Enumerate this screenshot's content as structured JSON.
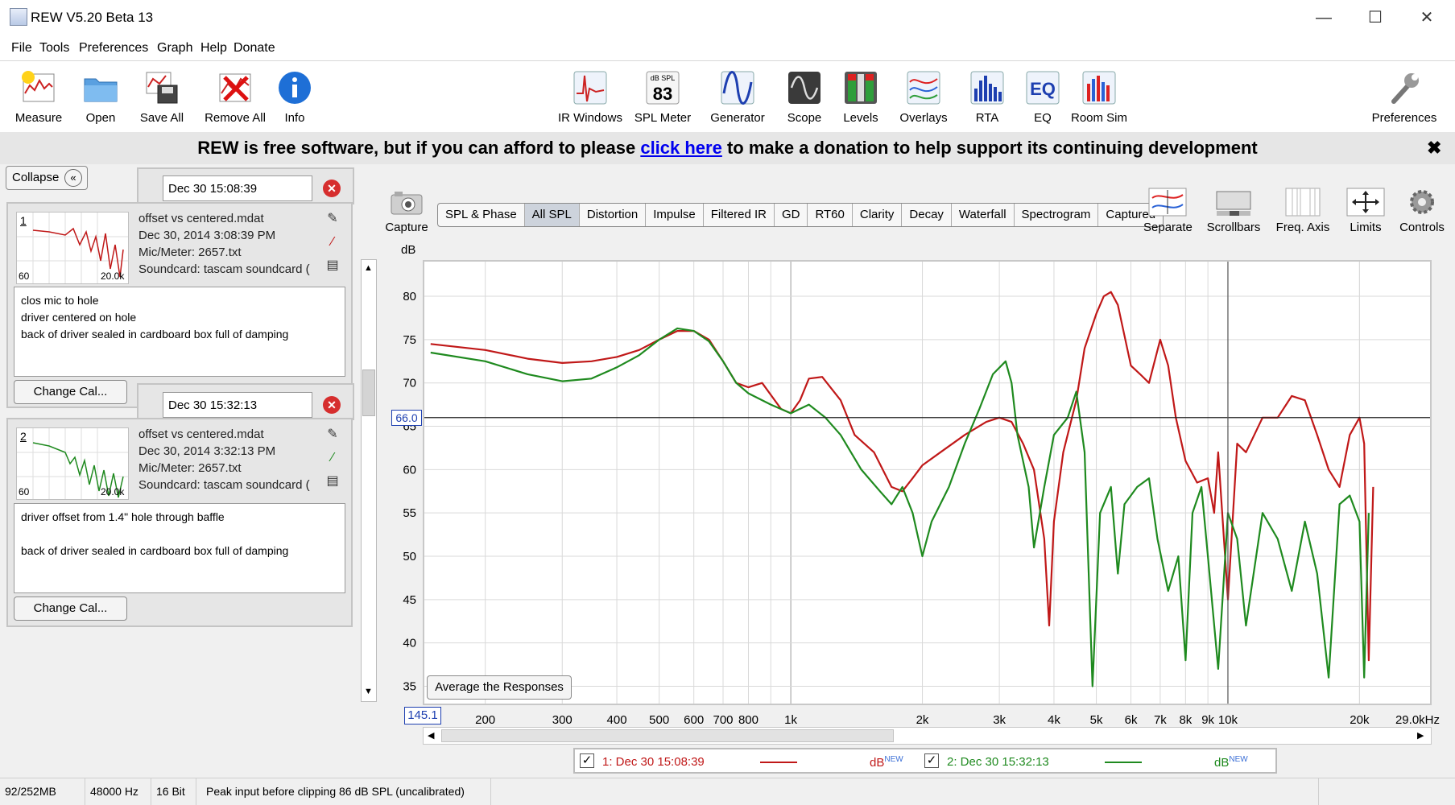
{
  "window": {
    "title": "REW V5.20 Beta 13"
  },
  "menu": [
    "File",
    "Tools",
    "Preferences",
    "Graph",
    "Help",
    "Donate"
  ],
  "toolbar": {
    "left": [
      {
        "label": "Measure",
        "icon": "measure-icon"
      },
      {
        "label": "Open",
        "icon": "folder-icon"
      },
      {
        "label": "Save All",
        "icon": "save-icon"
      },
      {
        "label": "Remove All",
        "icon": "remove-icon"
      },
      {
        "label": "Info",
        "icon": "info-icon"
      }
    ],
    "center": [
      {
        "label": "IR Windows",
        "icon": "ir-windows-icon"
      },
      {
        "label": "SPL Meter",
        "icon": "spl-meter-icon"
      },
      {
        "label": "Generator",
        "icon": "generator-icon"
      },
      {
        "label": "Scope",
        "icon": "scope-icon"
      },
      {
        "label": "Levels",
        "icon": "levels-icon"
      },
      {
        "label": "Overlays",
        "icon": "overlays-icon"
      },
      {
        "label": "RTA",
        "icon": "rta-icon"
      },
      {
        "label": "EQ",
        "icon": "eq-icon"
      },
      {
        "label": "Room Sim",
        "icon": "room-sim-icon"
      }
    ],
    "spl_icon_text": "dB SPL",
    "spl_icon_value": "83",
    "eq_icon_text": "EQ",
    "right": {
      "label": "Preferences",
      "icon": "wrench-icon"
    }
  },
  "donate": {
    "before": "REW is free software, but if you can afford to please ",
    "link": "click here",
    "after": " to make a donation to help support its continuing development"
  },
  "panel": {
    "collapse": "Collapse",
    "measurements": [
      {
        "num": "1",
        "date_field": "Dec 30 15:08:39",
        "file": "offset vs centered.mdat",
        "timestamp": "Dec 30, 2014 3:08:39 PM",
        "mic": "Mic/Meter: 2657.txt",
        "soundcard": "Soundcard: tascam soundcard (",
        "notes": [
          "clos mic  to hole",
          "driver centered on hole",
          "back of driver sealed in cardboard box full of damping"
        ],
        "thumb_min": "60",
        "thumb_max": "20.0k",
        "change_cal": "Change Cal..."
      },
      {
        "num": "2",
        "date_field": "Dec 30 15:32:13",
        "file": "offset vs centered.mdat",
        "timestamp": "Dec 30, 2014 3:32:13 PM",
        "mic": "Mic/Meter: 2657.txt",
        "soundcard": "Soundcard: tascam soundcard (",
        "notes": [
          "driver offset from 1.4\" hole through baffle",
          "",
          "back of driver sealed in cardboard box full of damping"
        ],
        "thumb_min": "60",
        "thumb_max": "20.0k",
        "change_cal": "Change Cal..."
      }
    ]
  },
  "graph": {
    "tabs": [
      "SPL & Phase",
      "All SPL",
      "Distortion",
      "Impulse",
      "Filtered IR",
      "GD",
      "RT60",
      "Clarity",
      "Decay",
      "Waterfall",
      "Spectrogram",
      "Captured"
    ],
    "selected_tab": "All SPL",
    "capture": "Capture",
    "right_tools": [
      "Separate",
      "Scrollbars",
      "Freq. Axis",
      "Limits",
      "Controls"
    ],
    "average_button": "Average the Responses",
    "cursor_level": "66.0",
    "cursor_freq": "145.1"
  },
  "chart_data": {
    "type": "line",
    "ylabel": "dB",
    "xscale": "log",
    "xlim": [
      145.1,
      29000
    ],
    "ylim": [
      33,
      84
    ],
    "y_ticks": [
      80,
      75,
      70,
      65,
      60,
      55,
      50,
      45,
      40,
      35
    ],
    "x_ticks": [
      {
        "v": 200,
        "t": "200"
      },
      {
        "v": 300,
        "t": "300"
      },
      {
        "v": 400,
        "t": "400"
      },
      {
        "v": 500,
        "t": "500"
      },
      {
        "v": 600,
        "t": "600"
      },
      {
        "v": 700,
        "t": "700"
      },
      {
        "v": 800,
        "t": "800"
      },
      {
        "v": 1000,
        "t": "1k"
      },
      {
        "v": 2000,
        "t": "2k"
      },
      {
        "v": 3000,
        "t": "3k"
      },
      {
        "v": 4000,
        "t": "4k"
      },
      {
        "v": 5000,
        "t": "5k"
      },
      {
        "v": 6000,
        "t": "6k"
      },
      {
        "v": 7000,
        "t": "7k"
      },
      {
        "v": 8000,
        "t": "8k"
      },
      {
        "v": 9000,
        "t": "9k"
      },
      {
        "v": 10000,
        "t": "10k"
      },
      {
        "v": 20000,
        "t": "20k"
      },
      {
        "v": 29000,
        "t": "29.0kHz"
      }
    ],
    "grid": true,
    "series": [
      {
        "name": "1: Dec 30 15:08:39",
        "color": "#c01818",
        "points": [
          [
            150,
            74.5
          ],
          [
            200,
            73.8
          ],
          [
            250,
            72.8
          ],
          [
            300,
            72.3
          ],
          [
            350,
            72.5
          ],
          [
            400,
            73
          ],
          [
            450,
            73.8
          ],
          [
            500,
            75
          ],
          [
            550,
            76
          ],
          [
            600,
            76
          ],
          [
            650,
            75
          ],
          [
            700,
            72.5
          ],
          [
            750,
            70
          ],
          [
            800,
            69.5
          ],
          [
            860,
            70
          ],
          [
            950,
            67
          ],
          [
            1000,
            66.5
          ],
          [
            1050,
            68
          ],
          [
            1100,
            70.5
          ],
          [
            1180,
            70.7
          ],
          [
            1300,
            68
          ],
          [
            1400,
            64
          ],
          [
            1550,
            62
          ],
          [
            1700,
            58
          ],
          [
            1800,
            57.5
          ],
          [
            1900,
            59
          ],
          [
            2000,
            60.5
          ],
          [
            2200,
            62
          ],
          [
            2500,
            64
          ],
          [
            2800,
            65.5
          ],
          [
            3000,
            66
          ],
          [
            3200,
            65.5
          ],
          [
            3400,
            63
          ],
          [
            3600,
            60
          ],
          [
            3800,
            52
          ],
          [
            3900,
            42
          ],
          [
            4000,
            54
          ],
          [
            4200,
            62
          ],
          [
            4500,
            68
          ],
          [
            4700,
            74
          ],
          [
            5000,
            78
          ],
          [
            5200,
            80
          ],
          [
            5400,
            80.5
          ],
          [
            5600,
            79
          ],
          [
            6000,
            72
          ],
          [
            6300,
            71
          ],
          [
            6600,
            70
          ],
          [
            7000,
            75
          ],
          [
            7300,
            72
          ],
          [
            7600,
            66
          ],
          [
            8000,
            61
          ],
          [
            8500,
            58.5
          ],
          [
            9000,
            59
          ],
          [
            9300,
            55
          ],
          [
            9500,
            62
          ],
          [
            10000,
            45
          ],
          [
            10500,
            63
          ],
          [
            11000,
            62
          ],
          [
            12000,
            66
          ],
          [
            13000,
            66
          ],
          [
            14000,
            68.5
          ],
          [
            15000,
            68
          ],
          [
            16000,
            64
          ],
          [
            17000,
            60
          ],
          [
            18000,
            58
          ],
          [
            19000,
            64
          ],
          [
            20000,
            66
          ],
          [
            20500,
            63
          ],
          [
            21000,
            38
          ],
          [
            21500,
            58
          ]
        ]
      },
      {
        "name": "2: Dec 30 15:32:13",
        "color": "#1f8a1f",
        "points": [
          [
            150,
            73.5
          ],
          [
            200,
            72.5
          ],
          [
            250,
            71
          ],
          [
            300,
            70.2
          ],
          [
            350,
            70.5
          ],
          [
            400,
            71.8
          ],
          [
            450,
            73.2
          ],
          [
            500,
            75
          ],
          [
            550,
            76.3
          ],
          [
            600,
            76
          ],
          [
            650,
            74.8
          ],
          [
            700,
            72.5
          ],
          [
            750,
            70
          ],
          [
            800,
            68.8
          ],
          [
            900,
            67.5
          ],
          [
            1000,
            66.5
          ],
          [
            1100,
            67.5
          ],
          [
            1200,
            66
          ],
          [
            1300,
            64
          ],
          [
            1450,
            60
          ],
          [
            1600,
            57.5
          ],
          [
            1700,
            56
          ],
          [
            1800,
            58
          ],
          [
            1900,
            55
          ],
          [
            2000,
            50
          ],
          [
            2100,
            54
          ],
          [
            2300,
            58
          ],
          [
            2500,
            63
          ],
          [
            2700,
            67
          ],
          [
            2900,
            71
          ],
          [
            3100,
            72.5
          ],
          [
            3200,
            70
          ],
          [
            3300,
            64
          ],
          [
            3500,
            58
          ],
          [
            3600,
            51
          ],
          [
            3800,
            58
          ],
          [
            4000,
            64
          ],
          [
            4300,
            66
          ],
          [
            4500,
            69
          ],
          [
            4700,
            62
          ],
          [
            4900,
            35
          ],
          [
            5100,
            55
          ],
          [
            5400,
            58
          ],
          [
            5600,
            48
          ],
          [
            5800,
            56
          ],
          [
            6200,
            58
          ],
          [
            6600,
            59
          ],
          [
            6900,
            52
          ],
          [
            7300,
            46
          ],
          [
            7700,
            50
          ],
          [
            8000,
            38
          ],
          [
            8300,
            55
          ],
          [
            8700,
            58
          ],
          [
            9000,
            50
          ],
          [
            9500,
            37
          ],
          [
            10000,
            55
          ],
          [
            10500,
            52
          ],
          [
            11000,
            42
          ],
          [
            12000,
            55
          ],
          [
            13000,
            52
          ],
          [
            14000,
            46
          ],
          [
            15000,
            54
          ],
          [
            16000,
            48
          ],
          [
            17000,
            36
          ],
          [
            18000,
            56
          ],
          [
            19000,
            57
          ],
          [
            20000,
            54
          ],
          [
            20500,
            36
          ],
          [
            21000,
            55
          ]
        ]
      }
    ],
    "cursor": {
      "y": 66.0,
      "x": 10000
    }
  },
  "legend": [
    {
      "label": "1: Dec 30 15:08:39",
      "unit": "dB",
      "sup": "NEW",
      "color": "#c01818",
      "checked": true
    },
    {
      "label": "2: Dec 30 15:32:13",
      "unit": "dB",
      "sup": "NEW",
      "color": "#1f8a1f",
      "checked": true
    }
  ],
  "status": [
    "92/252MB",
    "48000 Hz",
    "16 Bit",
    "Peak input before clipping 86 dB SPL (uncalibrated)"
  ]
}
